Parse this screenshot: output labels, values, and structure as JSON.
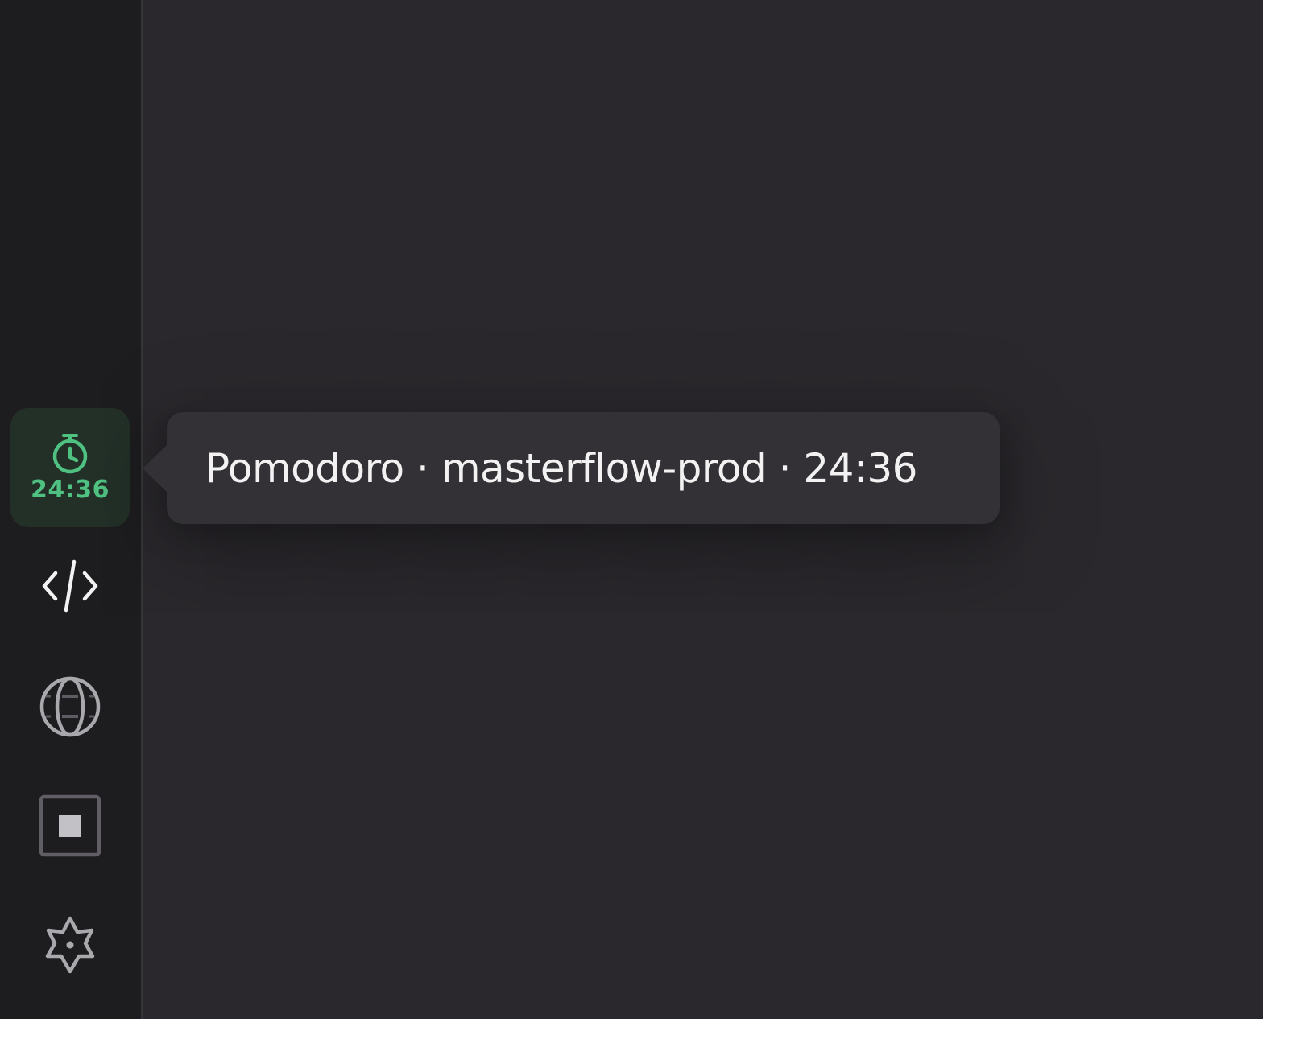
{
  "sidebar": {
    "timer": {
      "icon": "stopwatch-icon",
      "time": "24:36",
      "accent_color": "#4fc181"
    },
    "items": [
      {
        "name": "code",
        "icon": "code-icon"
      },
      {
        "name": "browser",
        "icon": "globe-icon"
      },
      {
        "name": "stop",
        "icon": "stop-icon"
      },
      {
        "name": "settings",
        "icon": "gear-icon"
      }
    ]
  },
  "tooltip": {
    "text": "Pomodoro · masterflow-prod · 24:36"
  }
}
